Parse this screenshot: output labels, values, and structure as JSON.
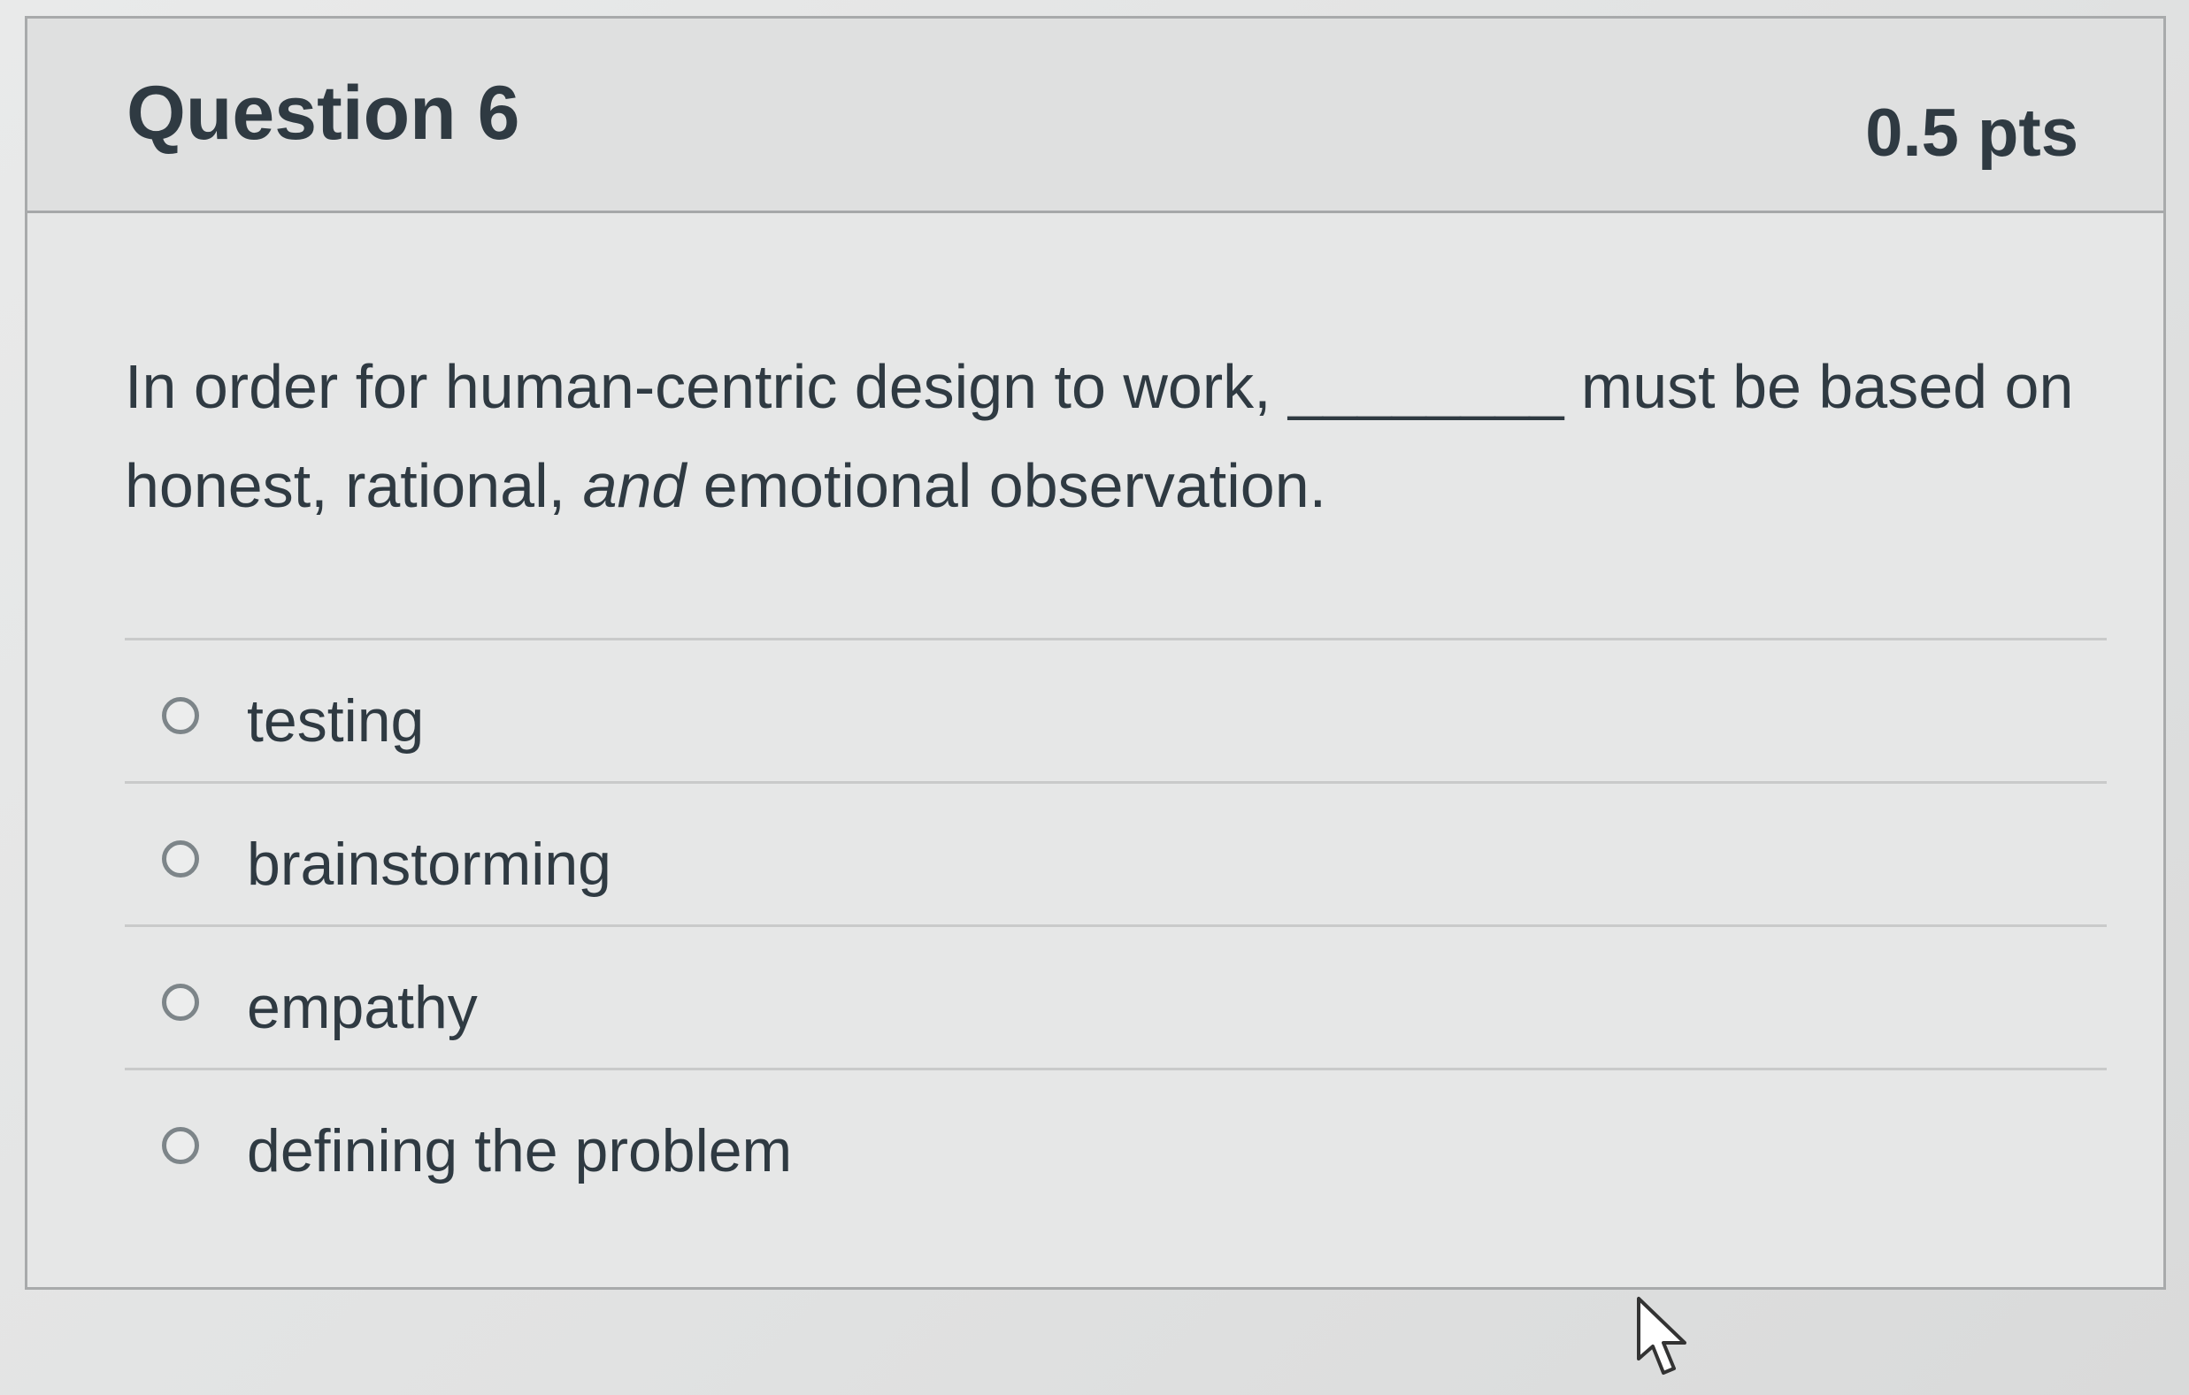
{
  "question": {
    "title": "Question 6",
    "points": "0.5 pts",
    "prompt": {
      "part1": "In order for human-centric design to work, ",
      "blank": "________",
      "part2": " must be based on honest, rational, ",
      "emphasis": "and",
      "part3": " emotional observation."
    }
  },
  "answers": [
    {
      "label": "testing"
    },
    {
      "label": "brainstorming"
    },
    {
      "label": "empathy"
    },
    {
      "label": "defining the problem"
    }
  ],
  "icons": {
    "radio": "radio-button-icon",
    "cursor": "mouse-pointer-icon"
  }
}
